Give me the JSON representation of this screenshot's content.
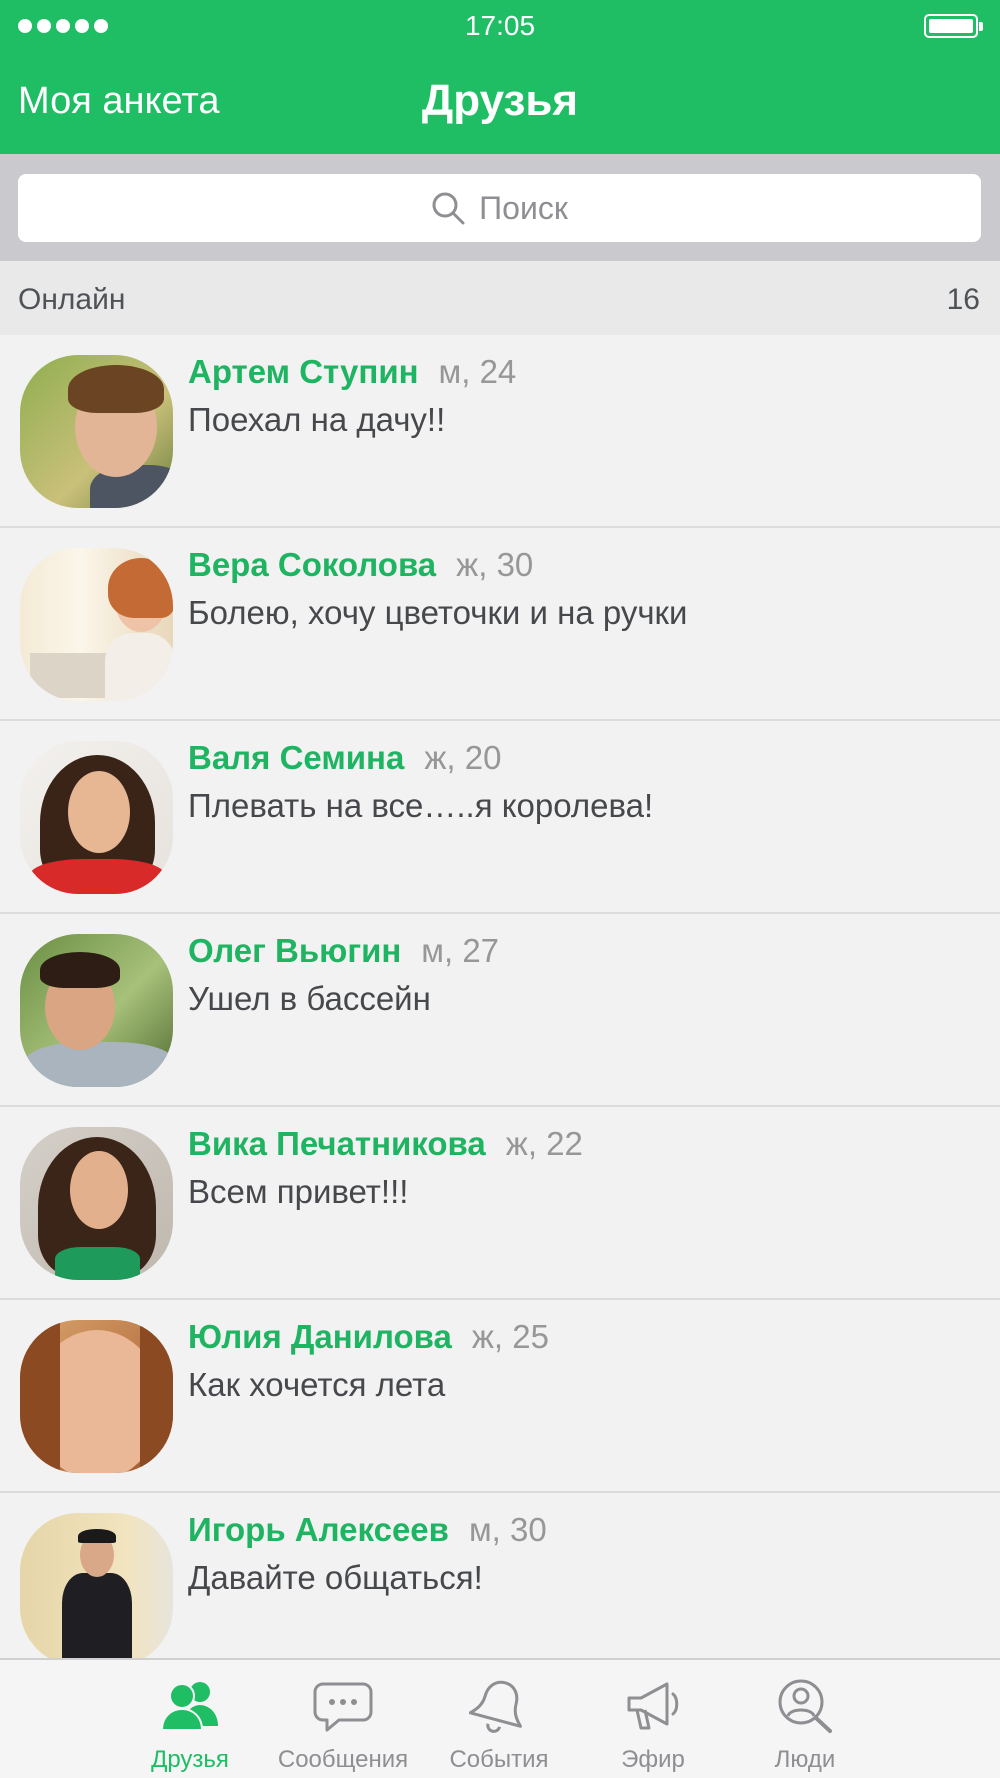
{
  "status_bar": {
    "time": "17:05"
  },
  "nav": {
    "left_label": "Моя анкета",
    "title": "Друзья"
  },
  "search": {
    "placeholder": "Поиск"
  },
  "section": {
    "label": "Онлайн",
    "count": "16"
  },
  "friends": [
    {
      "name": "Артем Ступин",
      "meta": "м, 24",
      "status": "Поехал на дачу!!"
    },
    {
      "name": "Вера Соколова",
      "meta": "ж, 30",
      "status": "Болею, хочу цветочки и на ручки"
    },
    {
      "name": "Валя Семина",
      "meta": "ж, 20",
      "status": "Плевать на все…..я королева!"
    },
    {
      "name": "Олег Вьюгин",
      "meta": "м, 27",
      "status": "Ушел в бассейн"
    },
    {
      "name": "Вика Печатникова",
      "meta": "ж, 22",
      "status": "Всем привет!!!"
    },
    {
      "name": "Юлия Данилова",
      "meta": "ж, 25",
      "status": "Как хочется лета"
    },
    {
      "name": "Игорь Алексеев",
      "meta": "м, 30",
      "status": "Давайте общаться!"
    }
  ],
  "tabs": [
    {
      "label": "Друзья",
      "icon": "friends-icon",
      "active": true
    },
    {
      "label": "Сообщения",
      "icon": "messages-icon",
      "active": false
    },
    {
      "label": "События",
      "icon": "bell-icon",
      "active": false
    },
    {
      "label": "Эфир",
      "icon": "megaphone-icon",
      "active": false
    },
    {
      "label": "Люди",
      "icon": "people-search-icon",
      "active": false
    }
  ],
  "colors": {
    "accent": "#1fbd64",
    "name": "#1fb462",
    "meta": "#979797",
    "inactive_tab": "#8e8e93"
  }
}
